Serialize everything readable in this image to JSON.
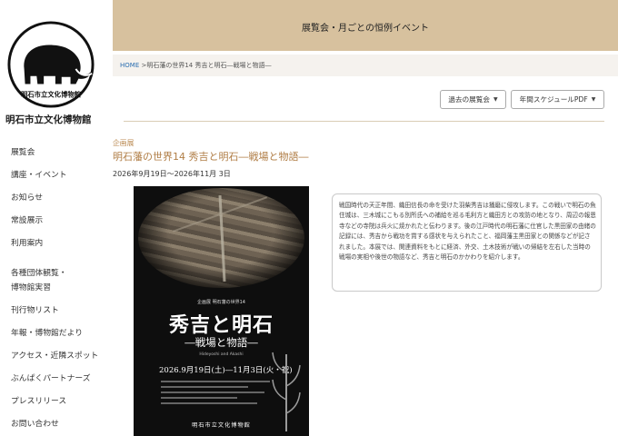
{
  "site": {
    "logo_text": "明石市立文化博物館",
    "name": "明石市立文化博物館"
  },
  "nav": {
    "items": [
      {
        "label": "展覧会"
      },
      {
        "label": "講座・イベント"
      },
      {
        "label": "お知らせ"
      },
      {
        "label": "常設展示"
      },
      {
        "label": "利用案内"
      },
      {
        "label": "各種団体観覧・"
      },
      {
        "label": "博物館実習"
      },
      {
        "label": "刊行物リスト"
      },
      {
        "label": "年報・博物館だより"
      },
      {
        "label": "アクセス・近隣スポット"
      },
      {
        "label": "ぶんぱくパートナーズ"
      },
      {
        "label": "プレスリリース"
      },
      {
        "label": "お問い合わせ"
      }
    ]
  },
  "header": {
    "title": "展覧会・月ごとの恒例イベント"
  },
  "breadcrumb": {
    "home": "HOME",
    "separator": " >",
    "current": "明石藩の世界14 秀吉と明石―戦場と物語―"
  },
  "buttons": {
    "past": "過去の展覧会",
    "pdf": "年間スケジュールPDF",
    "caret": "▼"
  },
  "exhibition": {
    "category": "企画展",
    "title": "明石藩の世界14 秀吉と明石―戦場と物語―",
    "dates": "2026年9月19日〜2026年11月 3日",
    "description": "戦国時代の天正年間、織田信長の命を受けた羽柴秀吉は播磨に侵攻します。この戦いで明石の魚住城は、三木城にこもる別所氏への補給を巡る毛利方と織田方との攻防の地となり、周辺の報恩寺などの寺院は兵火に焼かれたと伝わります。後の江戸時代の明石藩に仕官した黒田家の由緒の記録には、秀吉から戦功を賞する感状を与えられたこと、福岡藩主黒田家との関係などが記されました。本展では、関連資料をもとに経済、外交、土木技術が戦いの帰結を左右した当時の戦場の実相や後世の物語など、秀吉と明石のかかわりを紹介します。"
  },
  "poster": {
    "subhead": "企画展 明石藩の世界14",
    "main_title": "秀吉と明石",
    "subtitle": "―戦場と物語―",
    "english": "Hideyoshi and Akashi",
    "date_strip": "2026.9月19日(土)―11月3日(火・祝)",
    "footer": "明石市立文化博物館"
  },
  "colors": {
    "header_band": "#d7c19e",
    "accent_title": "#b07d45",
    "link": "#2a6db0"
  }
}
